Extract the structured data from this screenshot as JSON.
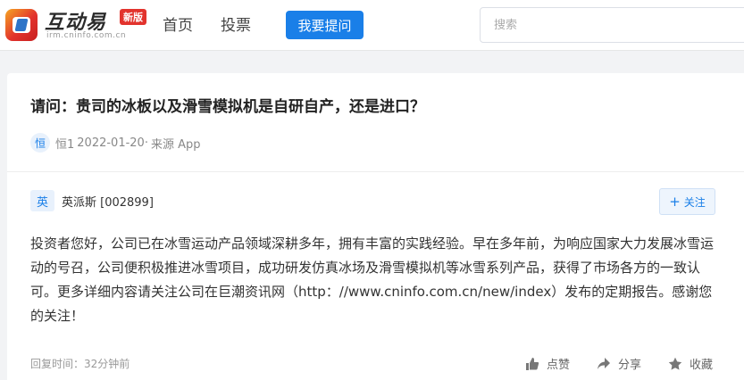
{
  "header": {
    "logo_text": "互动易",
    "logo_domain": "irm.cninfo.com.cn",
    "logo_badge": "新版",
    "nav": [
      "首页",
      "投票"
    ],
    "ask_button": "我要提问",
    "search_placeholder": "搜索"
  },
  "question": {
    "title": "请问：贵司的冰板以及滑雪模拟机是自研自产，还是进口？",
    "asker_avatar": "恒",
    "asker_name": "恒1",
    "date": "2022-01-20·",
    "source": "来源 App"
  },
  "answer": {
    "avatar": "英",
    "company": "英派斯 [002899]",
    "follow_label": "关注",
    "text": "投资者您好，公司已在冰雪运动产品领域深耕多年，拥有丰富的实践经验。早在多年前，为响应国家大力发展冰雪运动的号召，公司便积极推进冰雪项目，成功研发仿真冰场及滑雪模拟机等冰雪系列产品，获得了市场各方的一致认可。更多详细内容请关注公司在巨潮资讯网（http：//www.cninfo.com.cn/new/index）发布的定期报告。感谢您的关注！",
    "reply_time": "回复时间：32分钟前",
    "actions": {
      "like": "点赞",
      "share": "分享",
      "favorite": "收藏"
    }
  },
  "colors": {
    "brand_blue": "#1a7fe8",
    "logo_red": "#e2332d"
  },
  "icons": [
    "logo-icon",
    "plus-icon",
    "thumbs-up-icon",
    "share-icon",
    "star-icon"
  ]
}
